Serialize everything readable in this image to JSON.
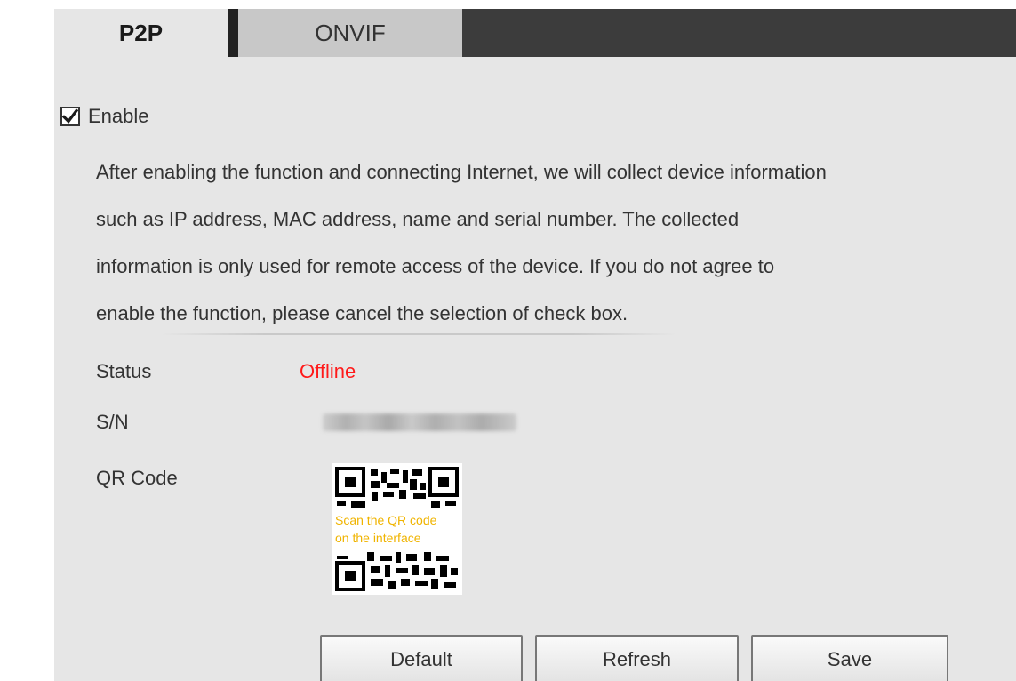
{
  "tabs": [
    {
      "label": "P2P",
      "active": true
    },
    {
      "label": "ONVIF",
      "active": false
    }
  ],
  "enable": {
    "label": "Enable",
    "checked": true
  },
  "notice_lines": [
    "After enabling the function and connecting Internet, we will collect device information",
    "such as IP address, MAC address, name and serial number. The collected",
    "information is only used for remote access of the device. If you do not agree to",
    "enable the function, please cancel the selection of check box."
  ],
  "fields": {
    "status_label": "Status",
    "status_value": "Offline",
    "sn_label": "S/N",
    "qr_label": "QR Code"
  },
  "qr_caption": [
    "Scan the QR code",
    "on the interface"
  ],
  "buttons": {
    "default": "Default",
    "refresh": "Refresh",
    "save": "Save"
  },
  "colors": {
    "status_offline": "#ff1a1a",
    "qr_caption_text": "#f0b400",
    "tab_bar": "#3c3c3c"
  }
}
